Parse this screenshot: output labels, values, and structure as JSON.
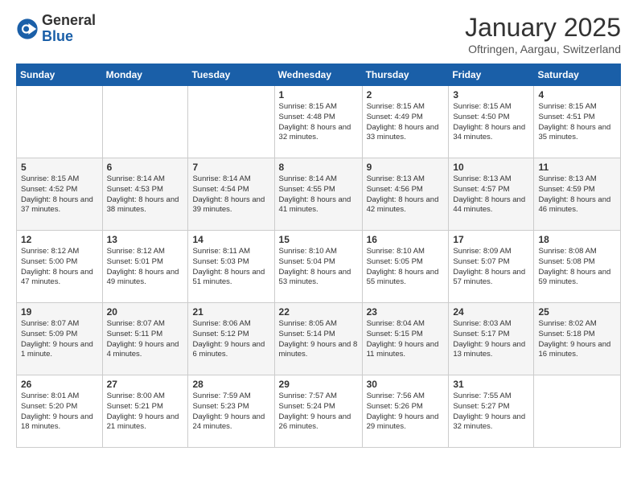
{
  "header": {
    "logo": {
      "general": "General",
      "blue": "Blue"
    },
    "title": "January 2025",
    "location": "Oftringen, Aargau, Switzerland"
  },
  "weekdays": [
    "Sunday",
    "Monday",
    "Tuesday",
    "Wednesday",
    "Thursday",
    "Friday",
    "Saturday"
  ],
  "weeks": [
    [
      {
        "day": "",
        "info": ""
      },
      {
        "day": "",
        "info": ""
      },
      {
        "day": "",
        "info": ""
      },
      {
        "day": "1",
        "info": "Sunrise: 8:15 AM\nSunset: 4:48 PM\nDaylight: 8 hours and 32 minutes."
      },
      {
        "day": "2",
        "info": "Sunrise: 8:15 AM\nSunset: 4:49 PM\nDaylight: 8 hours and 33 minutes."
      },
      {
        "day": "3",
        "info": "Sunrise: 8:15 AM\nSunset: 4:50 PM\nDaylight: 8 hours and 34 minutes."
      },
      {
        "day": "4",
        "info": "Sunrise: 8:15 AM\nSunset: 4:51 PM\nDaylight: 8 hours and 35 minutes."
      }
    ],
    [
      {
        "day": "5",
        "info": "Sunrise: 8:15 AM\nSunset: 4:52 PM\nDaylight: 8 hours and 37 minutes."
      },
      {
        "day": "6",
        "info": "Sunrise: 8:14 AM\nSunset: 4:53 PM\nDaylight: 8 hours and 38 minutes."
      },
      {
        "day": "7",
        "info": "Sunrise: 8:14 AM\nSunset: 4:54 PM\nDaylight: 8 hours and 39 minutes."
      },
      {
        "day": "8",
        "info": "Sunrise: 8:14 AM\nSunset: 4:55 PM\nDaylight: 8 hours and 41 minutes."
      },
      {
        "day": "9",
        "info": "Sunrise: 8:13 AM\nSunset: 4:56 PM\nDaylight: 8 hours and 42 minutes."
      },
      {
        "day": "10",
        "info": "Sunrise: 8:13 AM\nSunset: 4:57 PM\nDaylight: 8 hours and 44 minutes."
      },
      {
        "day": "11",
        "info": "Sunrise: 8:13 AM\nSunset: 4:59 PM\nDaylight: 8 hours and 46 minutes."
      }
    ],
    [
      {
        "day": "12",
        "info": "Sunrise: 8:12 AM\nSunset: 5:00 PM\nDaylight: 8 hours and 47 minutes."
      },
      {
        "day": "13",
        "info": "Sunrise: 8:12 AM\nSunset: 5:01 PM\nDaylight: 8 hours and 49 minutes."
      },
      {
        "day": "14",
        "info": "Sunrise: 8:11 AM\nSunset: 5:03 PM\nDaylight: 8 hours and 51 minutes."
      },
      {
        "day": "15",
        "info": "Sunrise: 8:10 AM\nSunset: 5:04 PM\nDaylight: 8 hours and 53 minutes."
      },
      {
        "day": "16",
        "info": "Sunrise: 8:10 AM\nSunset: 5:05 PM\nDaylight: 8 hours and 55 minutes."
      },
      {
        "day": "17",
        "info": "Sunrise: 8:09 AM\nSunset: 5:07 PM\nDaylight: 8 hours and 57 minutes."
      },
      {
        "day": "18",
        "info": "Sunrise: 8:08 AM\nSunset: 5:08 PM\nDaylight: 8 hours and 59 minutes."
      }
    ],
    [
      {
        "day": "19",
        "info": "Sunrise: 8:07 AM\nSunset: 5:09 PM\nDaylight: 9 hours and 1 minute."
      },
      {
        "day": "20",
        "info": "Sunrise: 8:07 AM\nSunset: 5:11 PM\nDaylight: 9 hours and 4 minutes."
      },
      {
        "day": "21",
        "info": "Sunrise: 8:06 AM\nSunset: 5:12 PM\nDaylight: 9 hours and 6 minutes."
      },
      {
        "day": "22",
        "info": "Sunrise: 8:05 AM\nSunset: 5:14 PM\nDaylight: 9 hours and 8 minutes."
      },
      {
        "day": "23",
        "info": "Sunrise: 8:04 AM\nSunset: 5:15 PM\nDaylight: 9 hours and 11 minutes."
      },
      {
        "day": "24",
        "info": "Sunrise: 8:03 AM\nSunset: 5:17 PM\nDaylight: 9 hours and 13 minutes."
      },
      {
        "day": "25",
        "info": "Sunrise: 8:02 AM\nSunset: 5:18 PM\nDaylight: 9 hours and 16 minutes."
      }
    ],
    [
      {
        "day": "26",
        "info": "Sunrise: 8:01 AM\nSunset: 5:20 PM\nDaylight: 9 hours and 18 minutes."
      },
      {
        "day": "27",
        "info": "Sunrise: 8:00 AM\nSunset: 5:21 PM\nDaylight: 9 hours and 21 minutes."
      },
      {
        "day": "28",
        "info": "Sunrise: 7:59 AM\nSunset: 5:23 PM\nDaylight: 9 hours and 24 minutes."
      },
      {
        "day": "29",
        "info": "Sunrise: 7:57 AM\nSunset: 5:24 PM\nDaylight: 9 hours and 26 minutes."
      },
      {
        "day": "30",
        "info": "Sunrise: 7:56 AM\nSunset: 5:26 PM\nDaylight: 9 hours and 29 minutes."
      },
      {
        "day": "31",
        "info": "Sunrise: 7:55 AM\nSunset: 5:27 PM\nDaylight: 9 hours and 32 minutes."
      },
      {
        "day": "",
        "info": ""
      }
    ]
  ]
}
